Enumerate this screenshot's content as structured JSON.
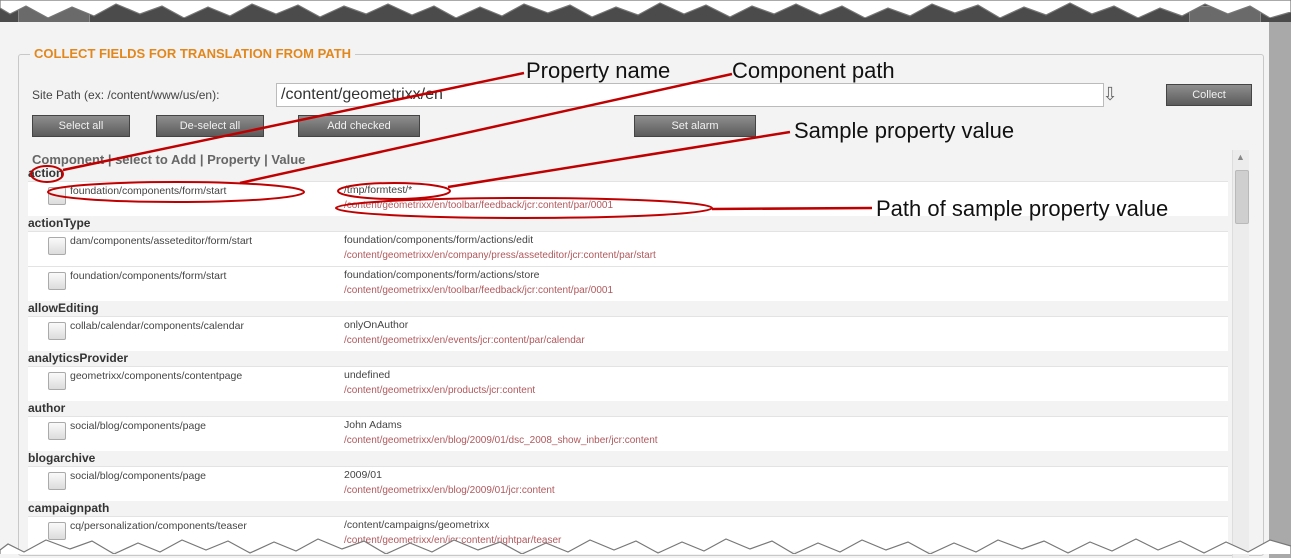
{
  "section_title": "COLLECT FIELDS FOR TRANSLATION FROM PATH",
  "site_path": {
    "label": "Site Path (ex: /content/www/us/en):",
    "value": "/content/geometrixx/en"
  },
  "buttons": {
    "select_all": "Select all",
    "deselect_all": "De-select all",
    "add_checked": "Add checked",
    "set_alarm": "Set alarm",
    "collect": "Collect"
  },
  "list_header": "Component | select to Add | Property | Value",
  "groups": [
    {
      "property": "action",
      "rows": [
        {
          "component": "foundation/components/form/start",
          "value": "/tmp/formtest/*",
          "path": "/content/geometrixx/en/toolbar/feedback/jcr:content/par/0001"
        }
      ]
    },
    {
      "property": "actionType",
      "rows": [
        {
          "component": "dam/components/asseteditor/form/start",
          "value": "foundation/components/form/actions/edit",
          "path": "/content/geometrixx/en/company/press/asseteditor/jcr:content/par/start"
        },
        {
          "component": "foundation/components/form/start",
          "value": "foundation/components/form/actions/store",
          "path": "/content/geometrixx/en/toolbar/feedback/jcr:content/par/0001"
        }
      ]
    },
    {
      "property": "allowEditing",
      "rows": [
        {
          "component": "collab/calendar/components/calendar",
          "value": "onlyOnAuthor",
          "path": "/content/geometrixx/en/events/jcr:content/par/calendar"
        }
      ]
    },
    {
      "property": "analyticsProvider",
      "rows": [
        {
          "component": "geometrixx/components/contentpage",
          "value": "undefined",
          "path": "/content/geometrixx/en/products/jcr:content"
        }
      ]
    },
    {
      "property": "author",
      "rows": [
        {
          "component": "social/blog/components/page",
          "value": "John Adams",
          "path": "/content/geometrixx/en/blog/2009/01/dsc_2008_show_inber/jcr:content"
        }
      ]
    },
    {
      "property": "blogarchive",
      "rows": [
        {
          "component": "social/blog/components/page",
          "value": "2009/01",
          "path": "/content/geometrixx/en/blog/2009/01/jcr:content"
        }
      ]
    },
    {
      "property": "campaignpath",
      "rows": [
        {
          "component": "cq/personalization/components/teaser",
          "value": "/content/campaigns/geometrixx",
          "path": "/content/geometrixx/en/jcr:content/rightpar/teaser"
        }
      ]
    }
  ],
  "annotations": {
    "property_name": "Property name",
    "component_path": "Component path",
    "sample_value": "Sample property value",
    "sample_path": "Path of sample property value"
  },
  "colors": {
    "legend": "#e2871d",
    "path_text": "#b0585c",
    "annotation_red": "#c00000"
  }
}
